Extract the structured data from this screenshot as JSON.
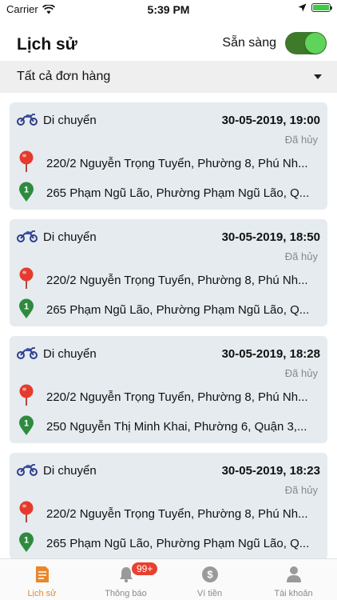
{
  "status_bar": {
    "carrier": "Carrier",
    "time": "5:39 PM"
  },
  "header": {
    "title": "Lịch sử",
    "ready_label": "Sẵn sàng",
    "ready_on": true
  },
  "filter": {
    "label": "Tất cả đơn hàng"
  },
  "orders": [
    {
      "type": "Di chuyển",
      "datetime": "30-05-2019, 19:00",
      "status": "Đã hủy",
      "origin": "220/2 Nguyễn Trọng Tuyển, Phường 8, Phú Nh...",
      "dest_no": "1",
      "destination": "265 Phạm Ngũ Lão, Phường Phạm Ngũ Lão, Q..."
    },
    {
      "type": "Di chuyển",
      "datetime": "30-05-2019, 18:50",
      "status": "Đã hủy",
      "origin": "220/2 Nguyễn Trọng Tuyển, Phường 8, Phú Nh...",
      "dest_no": "1",
      "destination": "265 Phạm Ngũ Lão, Phường Phạm Ngũ Lão, Q..."
    },
    {
      "type": "Di chuyển",
      "datetime": "30-05-2019, 18:28",
      "status": "Đã hủy",
      "origin": "220/2 Nguyễn Trọng Tuyển, Phường 8, Phú Nh...",
      "dest_no": "1",
      "destination": "250 Nguyễn Thị Minh Khai, Phường 6, Quận 3,..."
    },
    {
      "type": "Di chuyển",
      "datetime": "30-05-2019, 18:23",
      "status": "Đã hủy",
      "origin": "220/2 Nguyễn Trọng Tuyển, Phường 8, Phú Nh...",
      "dest_no": "1",
      "destination": "265 Phạm Ngũ Lão, Phường Phạm Ngũ Lão, Q..."
    }
  ],
  "tabs": [
    {
      "label": "Lịch sử",
      "icon": "document-icon",
      "active": true
    },
    {
      "label": "Thông báo",
      "icon": "bell-icon",
      "badge": "99+"
    },
    {
      "label": "Ví tiền",
      "icon": "wallet-icon"
    },
    {
      "label": "Tài khoản",
      "icon": "user-icon"
    }
  ],
  "colors": {
    "accent": "#e8872b",
    "toggle_on": "#3f7a2a",
    "card_bg": "#e5ebef",
    "origin_pin": "#e53a2e",
    "dest_pin": "#2e8b3e",
    "badge": "#e8412f"
  }
}
